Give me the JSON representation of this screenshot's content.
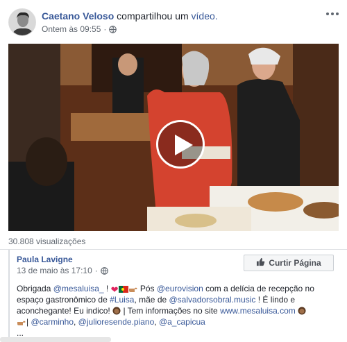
{
  "post": {
    "author": "Caetano Veloso",
    "action": "compartilhou um",
    "action_link": "vídeo.",
    "timestamp": "Ontem às 09:55",
    "separator": "·",
    "privacy_icon": "globe-icon",
    "more_icon": "ellipsis-icon"
  },
  "video": {
    "play_icon": "play-icon",
    "views": "30.808 visualizações"
  },
  "shared_page": {
    "author": "Paula Lavigne",
    "date": "13 de maio às 17:10",
    "separator": "·",
    "privacy_icon": "globe-icon",
    "like_button": "Curtir Página",
    "like_icon": "thumbs-up-icon",
    "text": {
      "l1_a": "Obrigada ",
      "l1_mention": "@mesaluisa_",
      "l1_b": " ! ",
      "l1_c": " Pós ",
      "l1_hashtag": "@eurovision",
      "l1_d": " com a delícia de recepção no",
      "l2_a": "espaço gastronômico de ",
      "l2_hashtag": "#Luisa",
      "l2_b": ", mãe de ",
      "l2_mention": "@salvadorsobral.music",
      "l2_c": " ! É lindo e",
      "l3_a": "aconchegante! Eu indico! ",
      "l3_b": " | Tem informações no site ",
      "l3_link": "www.mesaluisa.com",
      "l4_a": "| ",
      "l4_m1": "@carminho",
      "l4_sep1": ", ",
      "l4_m2": "@julioresende.piano",
      "l4_sep2": ", ",
      "l4_m3": "@a_capicua",
      "l5": "..."
    }
  },
  "colors": {
    "link": "#385898",
    "meta": "#606770",
    "text": "#1d2129",
    "heart": "#e0245e"
  }
}
